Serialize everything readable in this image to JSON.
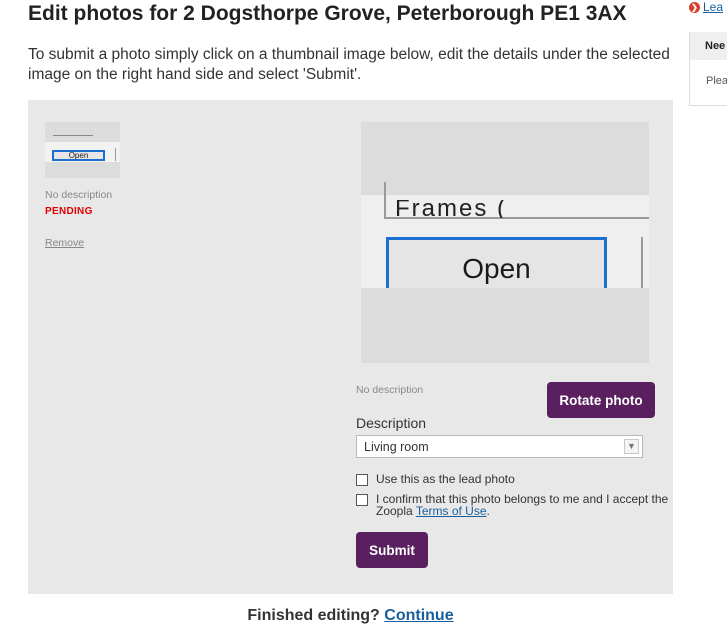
{
  "page": {
    "title": "Edit photos for 2 Dogsthorpe Grove, Peterborough PE1 3AX",
    "intro": "To submit a photo simply click on a thumbnail image below, edit the details under the selected image on the right hand side and select 'Submit'."
  },
  "thumbnail": {
    "image_text": "Open",
    "caption": "No description",
    "status": "PENDING",
    "remove_label": "Remove"
  },
  "preview": {
    "image_text": "Open",
    "cut_text": "Frames (",
    "caption": "No description",
    "rotate_label": "Rotate photo"
  },
  "form": {
    "description_label": "Description",
    "description_value": "Living room",
    "lead_photo_label": "Use this as the lead photo",
    "confirm_prefix": "I confirm that this photo belongs to me and I accept the",
    "confirm_suffix_pre": "Zoopla",
    "terms_link": "Terms of Use",
    "confirm_period": ".",
    "submit_label": "Submit"
  },
  "footer": {
    "finished_text": "Finished editing?",
    "continue_link": "Continue"
  },
  "sidebar": {
    "link_label": "Lea",
    "panel_heading": "Nee",
    "panel_text": "Plea"
  },
  "colors": {
    "button_purple": "#5a1f5e",
    "link_blue": "#1a5f9c",
    "status_red": "#e00000",
    "editor_bg": "#e8e8e8"
  },
  "icons": {
    "arrow": "circle-chevron-right-icon",
    "select": "chevron-down-icon"
  }
}
